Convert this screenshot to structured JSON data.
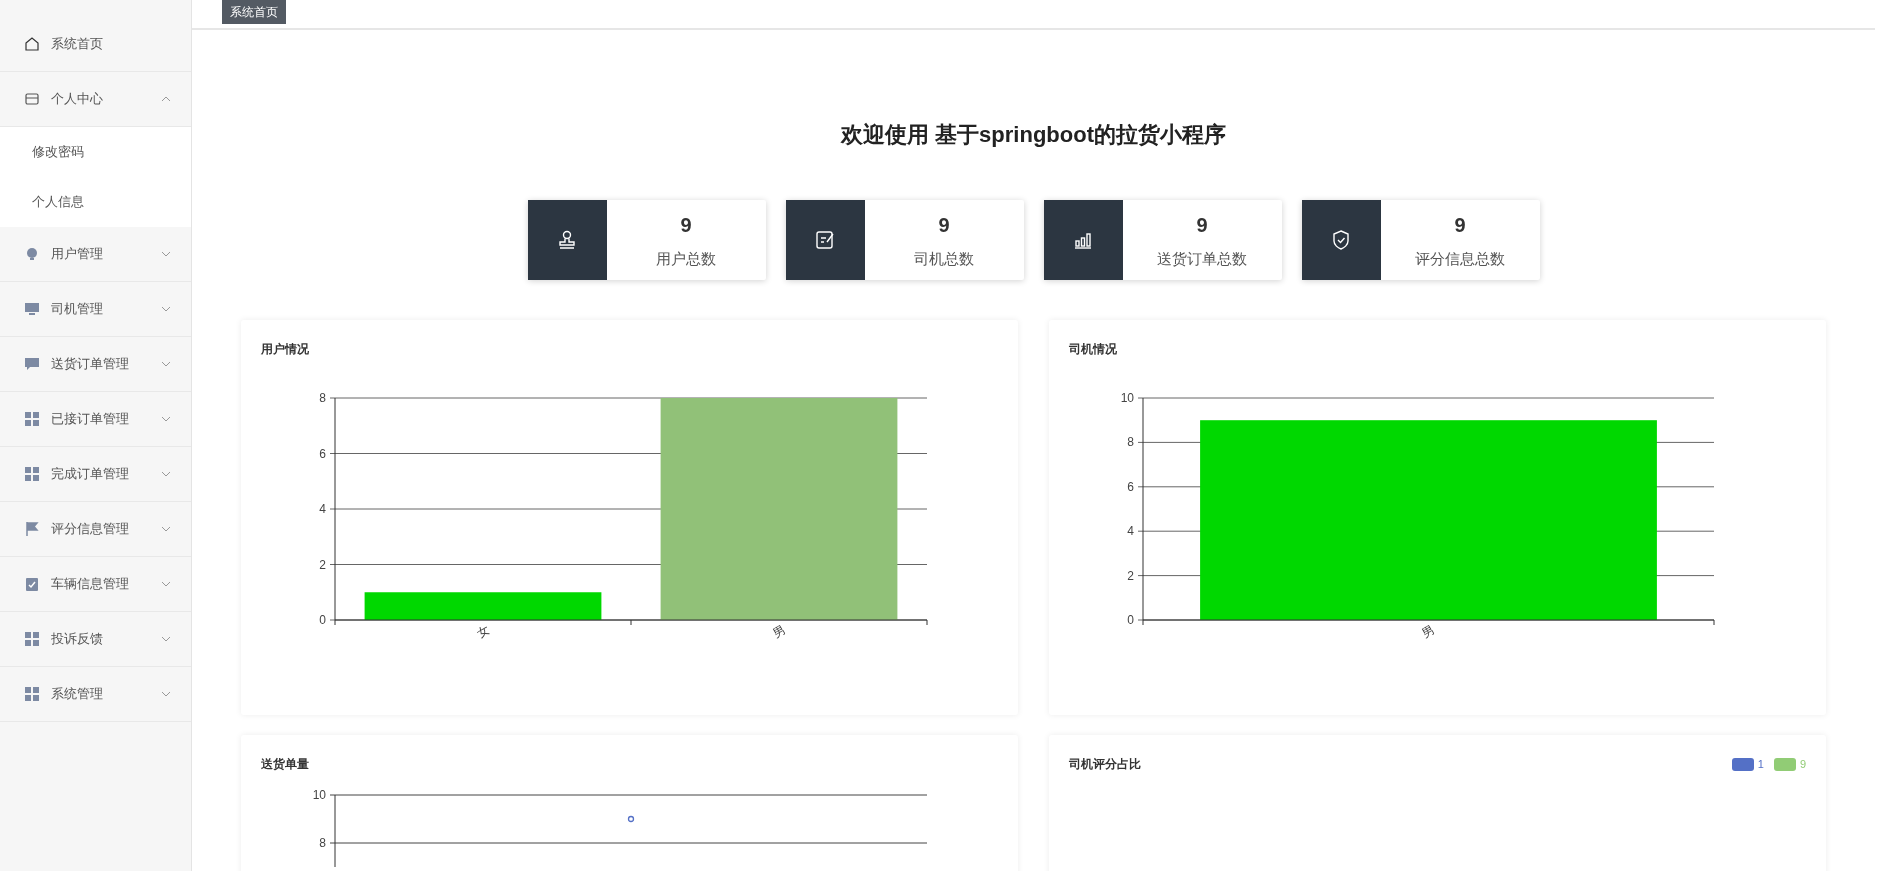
{
  "sidebar": {
    "items": [
      {
        "kind": "link",
        "label": "系统首页"
      },
      {
        "kind": "menu",
        "label": "个人中心",
        "expanded": true,
        "children": [
          {
            "label": "修改密码"
          },
          {
            "label": "个人信息"
          }
        ]
      },
      {
        "kind": "menu",
        "label": "用户管理",
        "expanded": false
      },
      {
        "kind": "menu",
        "label": "司机管理",
        "expanded": false
      },
      {
        "kind": "menu",
        "label": "送货订单管理",
        "expanded": false
      },
      {
        "kind": "menu",
        "label": "已接订单管理",
        "expanded": false
      },
      {
        "kind": "menu",
        "label": "完成订单管理",
        "expanded": false
      },
      {
        "kind": "menu",
        "label": "评分信息管理",
        "expanded": false
      },
      {
        "kind": "menu",
        "label": "车辆信息管理",
        "expanded": false
      },
      {
        "kind": "menu",
        "label": "投诉反馈",
        "expanded": false
      },
      {
        "kind": "menu",
        "label": "系统管理",
        "expanded": false
      }
    ]
  },
  "breadcrumb": {
    "tag": "系统首页"
  },
  "title": "欢迎使用 基于springboot的拉货小程序",
  "stats": [
    {
      "value": "9",
      "label": "用户总数"
    },
    {
      "value": "9",
      "label": "司机总数"
    },
    {
      "value": "9",
      "label": "送货订单总数"
    },
    {
      "value": "9",
      "label": "评分信息总数"
    }
  ],
  "panels": [
    {
      "title": "用户情况",
      "chart_data": {
        "type": "bar",
        "categories": [
          "女",
          "男"
        ],
        "series": [
          {
            "color": "#00d800",
            "values": [
              1,
              null
            ]
          },
          {
            "color": "#91c178",
            "values": [
              null,
              8
            ]
          }
        ],
        "ylim": [
          0,
          8
        ],
        "yticks": [
          0,
          2,
          4,
          6,
          8
        ],
        "grid": true
      }
    },
    {
      "title": "司机情况",
      "chart_data": {
        "type": "bar",
        "categories": [
          "男"
        ],
        "series": [
          {
            "color": "#00d800",
            "values": [
              9
            ]
          }
        ],
        "ylim": [
          0,
          10
        ],
        "yticks": [
          0,
          2,
          4,
          6,
          8,
          10
        ],
        "grid": true
      }
    },
    {
      "title": "送货单量",
      "chart_data": {
        "type": "line",
        "series": [
          {
            "color": "#5470c6",
            "values": [
              9
            ],
            "marker": "circle"
          }
        ],
        "ylim": [
          7,
          10
        ],
        "yticks": [
          8,
          10
        ]
      }
    },
    {
      "title": "司机评分占比",
      "legend": [
        {
          "label": "1",
          "color": "#5470c6"
        },
        {
          "label": "9",
          "color": "#91cc75"
        }
      ]
    }
  ]
}
